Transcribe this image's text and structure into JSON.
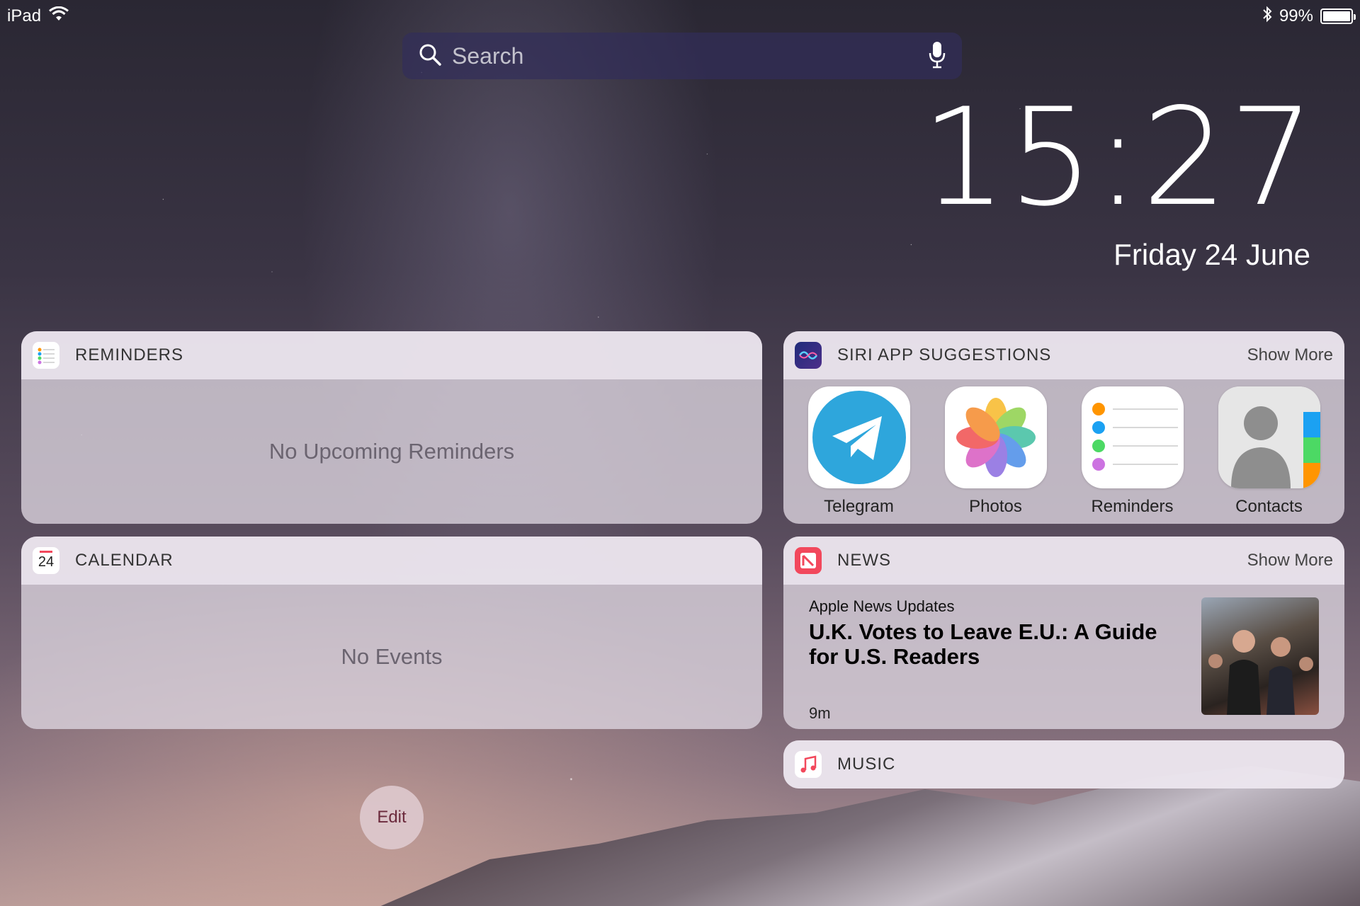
{
  "status_bar": {
    "device": "iPad",
    "battery": "99%",
    "battery_level": 0.99
  },
  "search": {
    "placeholder": "Search"
  },
  "lock": {
    "time": "15:27",
    "date": "Friday 24 June"
  },
  "widgets": {
    "reminders": {
      "title": "REMINDERS",
      "message": "No Upcoming Reminders"
    },
    "calendar": {
      "title": "CALENDAR",
      "icon_day": "24",
      "message": "No Events"
    },
    "siri": {
      "title": "SIRI APP SUGGESTIONS",
      "show_more": "Show More",
      "apps": [
        {
          "label": "Telegram",
          "icon": "telegram-icon"
        },
        {
          "label": "Photos",
          "icon": "photos-icon"
        },
        {
          "label": "Reminders",
          "icon": "reminders-icon"
        },
        {
          "label": "Contacts",
          "icon": "contacts-icon"
        }
      ]
    },
    "news": {
      "title": "NEWS",
      "show_more": "Show More",
      "source": "Apple News Updates",
      "headline": "U.K. Votes to Leave E.U.: A Guide for U.S. Readers",
      "age": "9m"
    },
    "music": {
      "title": "MUSIC"
    }
  },
  "edit_label": "Edit",
  "colors": {
    "telegram": "#2ea6dc",
    "news": "#f2485c",
    "music": "#f2485c",
    "edit_text": "#6b2a3c"
  }
}
